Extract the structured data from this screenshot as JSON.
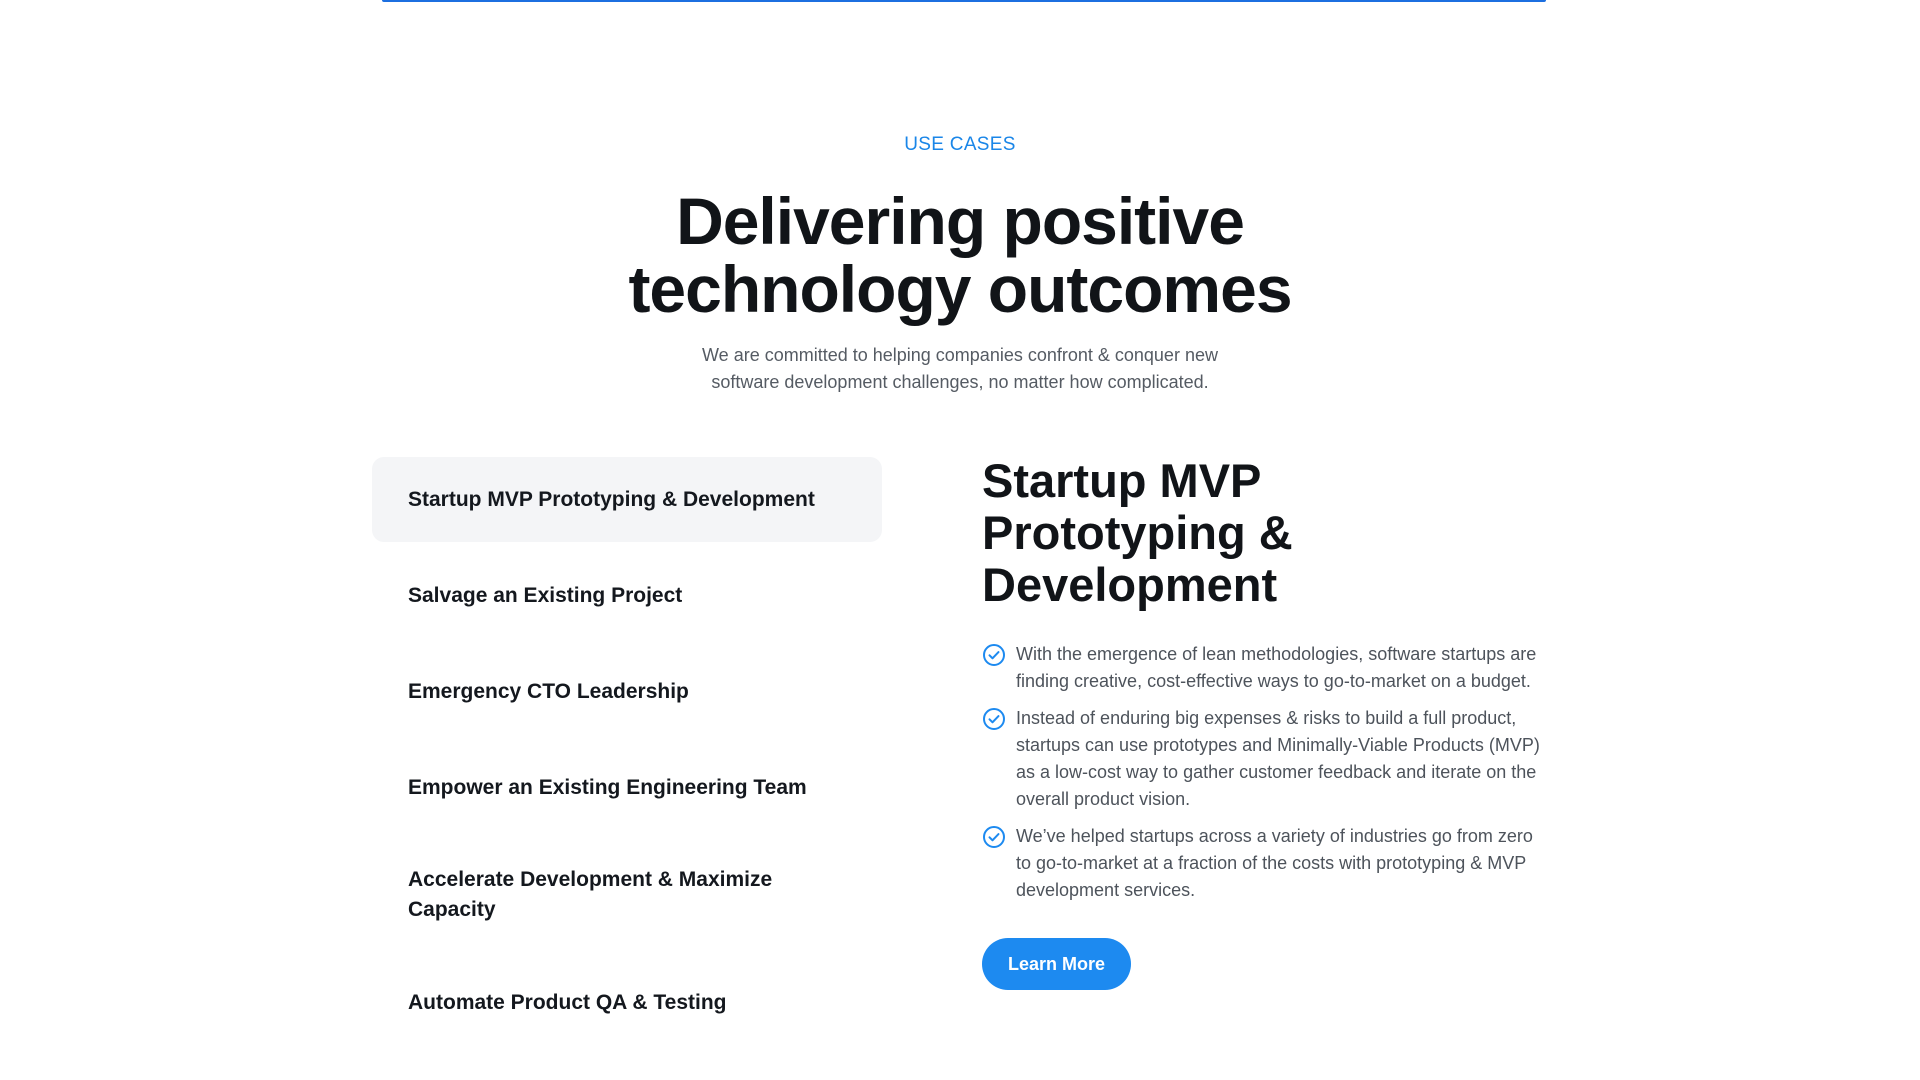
{
  "section": {
    "eyebrow": "USE CASES",
    "headline_line1": "Delivering positive",
    "headline_line2": "technology outcomes",
    "subtitle_line1": "We are committed to helping companies confront & conquer new",
    "subtitle_line2": "software development challenges, no matter how complicated."
  },
  "menu": {
    "items": [
      {
        "label": "Startup MVP Prototyping & Development"
      },
      {
        "label": "Salvage an Existing Project"
      },
      {
        "label": "Emergency CTO Leadership"
      },
      {
        "label": "Empower an Existing Engineering Team"
      },
      {
        "label": "Accelerate Development & Maximize Capacity"
      },
      {
        "label": "Automate Product QA & Testing"
      }
    ]
  },
  "detail": {
    "title": "Startup MVP Prototyping & Development",
    "bullets": [
      "With the emergence of lean methodologies, software startups are finding creative, cost-effective ways to go-to-market on a budget.",
      "Instead of enduring big expenses & risks to build a full product, startups can use prototypes and Minimally-Viable Products (MVP) as a low-cost way to gather customer feedback and iterate on the overall product vision.",
      "We’ve helped startups across a variety of industries go from zero to go-to-market at a fraction of the costs with prototyping & MVP development services."
    ],
    "bullet_icon": "check-circle-icon",
    "cta_label": "Learn More"
  },
  "colors": {
    "accent": "#1d8af0",
    "eyebrow": "#1a86e8",
    "active_item_bg": "#f4f5f7"
  }
}
